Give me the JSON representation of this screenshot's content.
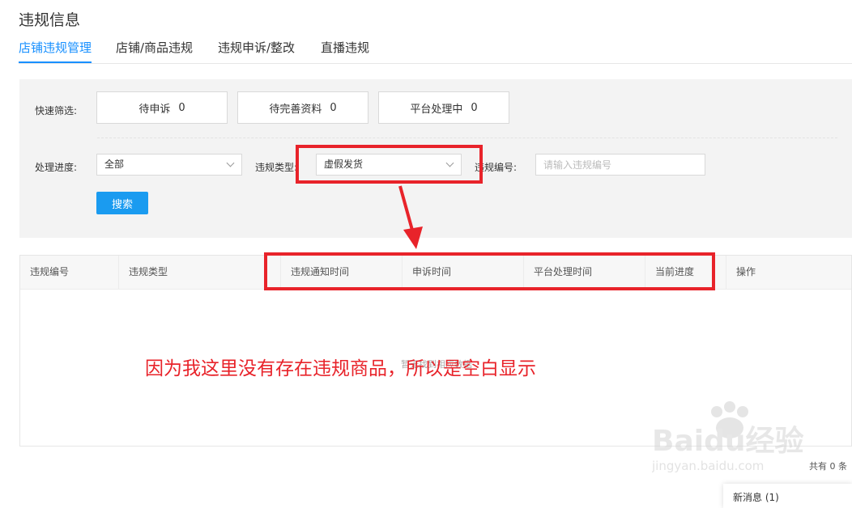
{
  "page_title": "违规信息",
  "tabs": [
    {
      "label": "店铺违规管理",
      "active": true
    },
    {
      "label": "店铺/商品违规",
      "active": false
    },
    {
      "label": "违规申诉/整改",
      "active": false
    },
    {
      "label": "直播违规",
      "active": false
    }
  ],
  "filters": {
    "quick_filter_label": "快速筛选:",
    "quick_cards": [
      {
        "label": "待申诉",
        "count": "0"
      },
      {
        "label": "待完善资料",
        "count": "0"
      },
      {
        "label": "平台处理中",
        "count": "0"
      }
    ],
    "progress_label": "处理进度:",
    "progress_value": "全部",
    "type_label": "违规类型:",
    "type_value": "虚假发货",
    "number_label": "违规编号:",
    "number_placeholder": "请输入违规编号",
    "search_button": "搜索"
  },
  "table": {
    "columns": [
      "违规编号",
      "违规类型",
      "违规通知时间",
      "申诉时间",
      "平台处理时间",
      "当前进度",
      "操作"
    ],
    "empty_text": "暂无找到相应数据"
  },
  "annotation_text": "因为我这里没有存在违规商品，所以是空白显示",
  "pagination": {
    "total_text": "共有 0 条"
  },
  "message_popup": "新消息 (1)",
  "watermark": {
    "text": "Baidu经验",
    "url": "jingyan.baidu.com"
  },
  "colors": {
    "accent": "#1890ff",
    "button": "#1a9bf0",
    "highlight": "#e8232a"
  }
}
